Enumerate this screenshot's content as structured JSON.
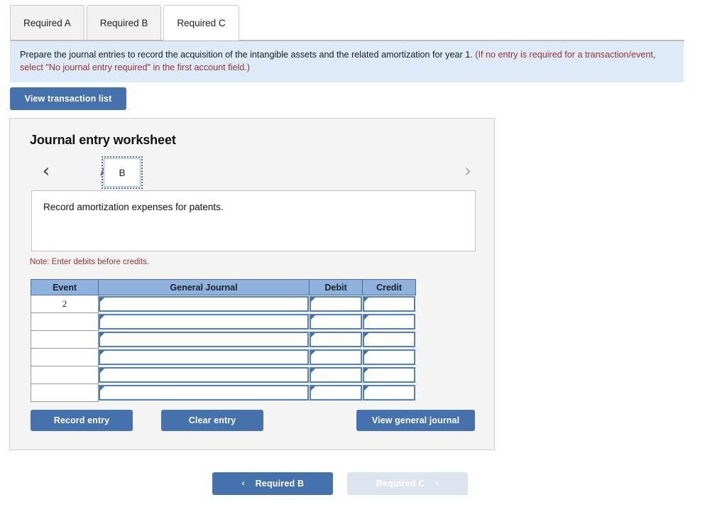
{
  "tabs": [
    {
      "label": "Required A",
      "active": false
    },
    {
      "label": "Required B",
      "active": false
    },
    {
      "label": "Required C",
      "active": true
    }
  ],
  "instructions": {
    "main": "Prepare the journal entries to record the acquisition of the intangible assets and the related amortization for year 1.",
    "hint": "(If no entry is required for a transaction/event, select \"No journal entry required\" in the first account field.)"
  },
  "toolbar": {
    "view_transaction_list_label": "View transaction list"
  },
  "worksheet": {
    "title": "Journal entry worksheet",
    "pager": {
      "prev_icon": "‹",
      "next_icon": "›",
      "items": [
        {
          "label": "A",
          "selected": false
        },
        {
          "label": "B",
          "selected": true
        }
      ]
    },
    "description": "Record amortization expenses for patents.",
    "note": "Note: Enter debits before credits.",
    "table": {
      "columns": [
        "Event",
        "General Journal",
        "Debit",
        "Credit"
      ],
      "rows": [
        {
          "event": "2",
          "general_journal": "",
          "debit": "",
          "credit": ""
        },
        {
          "event": "",
          "general_journal": "",
          "debit": "",
          "credit": ""
        },
        {
          "event": "",
          "general_journal": "",
          "debit": "",
          "credit": ""
        },
        {
          "event": "",
          "general_journal": "",
          "debit": "",
          "credit": ""
        },
        {
          "event": "",
          "general_journal": "",
          "debit": "",
          "credit": ""
        },
        {
          "event": "",
          "general_journal": "",
          "debit": "",
          "credit": ""
        }
      ]
    },
    "actions": {
      "record_entry_label": "Record entry",
      "clear_entry_label": "Clear entry",
      "view_general_journal_label": "View general journal"
    }
  },
  "footer_nav": {
    "prev": {
      "label": "Required B",
      "icon": "‹",
      "disabled": false
    },
    "next": {
      "label": "Required C",
      "icon": "›",
      "disabled": true
    }
  },
  "colors": {
    "primary_blue": "#4571ac",
    "banner_blue": "#ddeaf7",
    "table_header_blue": "#8eb2dc",
    "hint_red": "#9b3232",
    "disabled_blue": "#dbe4ef"
  }
}
